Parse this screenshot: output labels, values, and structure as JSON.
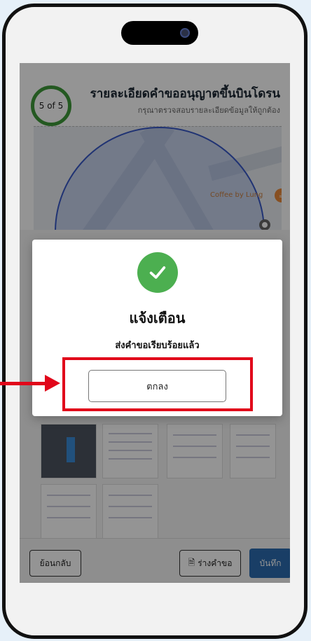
{
  "header": {
    "step": "5 of 5",
    "title": "รายละเอียดคำขออนุญาตขึ้นบินโดรน",
    "subtitle": "กรุณาตรวจสอบรายละเอียดข้อมูลให้ถูกต้อง"
  },
  "map": {
    "poi_label": "Coffee by Lung"
  },
  "footer": {
    "back_label": "ย้อนกลับ",
    "draft_label": "ร่างคำขอ",
    "save_label": "บันทึก"
  },
  "dialog": {
    "title": "แจ้งเตือน",
    "message": "ส่งคำขอเรียบร้อยแล้ว",
    "ok_label": "ตกลง"
  },
  "colors": {
    "success": "#4caf50",
    "highlight": "#e1061a",
    "primary": "#2b6cb0",
    "step_ring": "#3f9a3a"
  },
  "icons": {
    "check": "check-icon",
    "draft": "document-icon",
    "arrow": "arrow-right-icon"
  }
}
